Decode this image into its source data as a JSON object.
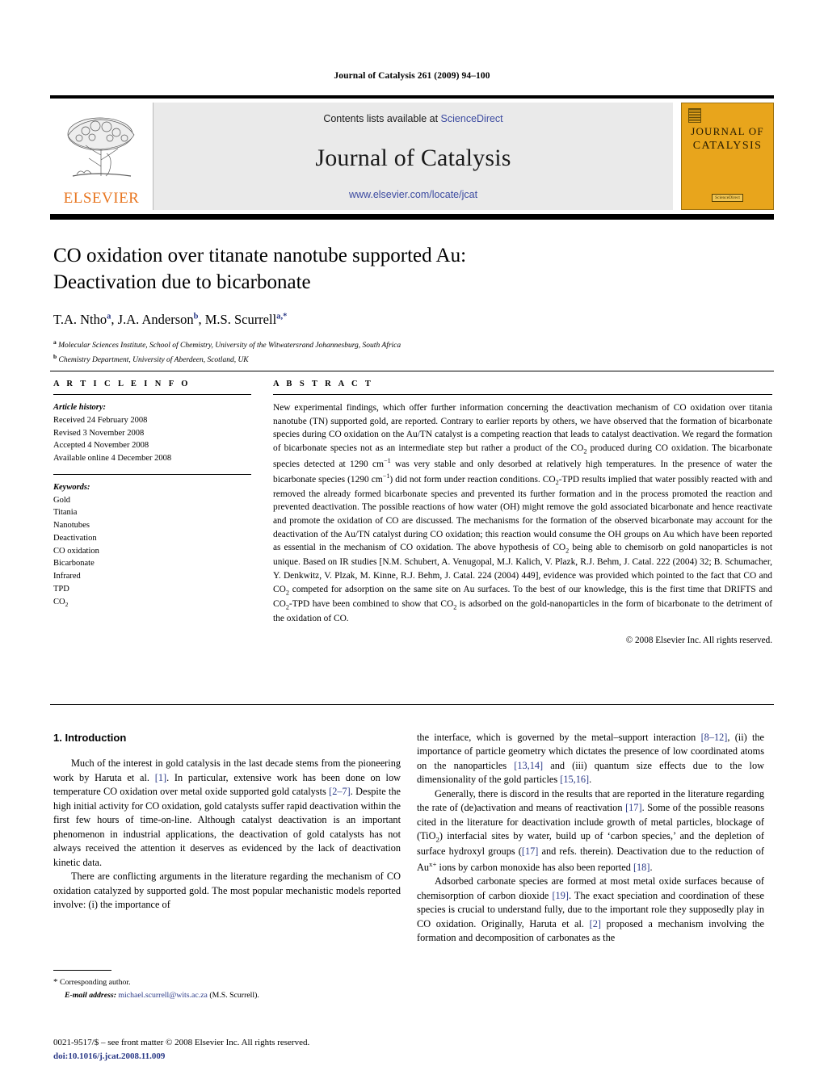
{
  "running_head": "Journal of Catalysis 261 (2009) 94–100",
  "masthead": {
    "contents_prefix": "Contents lists available at ",
    "sciencedirect": "ScienceDirect",
    "journal_name": "Journal of Catalysis",
    "journal_url": "www.elsevier.com/locate/jcat",
    "publisher_logo_text": "ELSEVIER",
    "cover": {
      "line1": "JOURNAL OF",
      "line2": "CATALYSIS",
      "badge": "ScienceDirect"
    },
    "accent_colors": {
      "elsevier_orange": "#E87722",
      "link_blue": "#3b4aa0",
      "cover_gold": "#E8A51C",
      "masthead_grey": "#eaeaea"
    }
  },
  "article": {
    "title_line1": "CO oxidation over titanate nanotube supported Au:",
    "title_line2": "Deactivation due to bicarbonate",
    "authors": [
      {
        "name": "T.A. Ntho",
        "marks": "a"
      },
      {
        "name": "J.A. Anderson",
        "marks": "b"
      },
      {
        "name": "M.S. Scurrell",
        "marks": "a,*"
      }
    ],
    "affiliations": [
      {
        "mark": "a",
        "text": "Molecular Sciences Institute, School of Chemistry, University of the Witwatersrand Johannesburg, South Africa"
      },
      {
        "mark": "b",
        "text": "Chemistry Department, University of Aberdeen, Scotland, UK"
      }
    ]
  },
  "article_info": {
    "heading": "A R T I C L E    I N F O",
    "history_label": "Article history:",
    "history": [
      "Received 24 February 2008",
      "Revised 3 November 2008",
      "Accepted 4 November 2008",
      "Available online 4 December 2008"
    ],
    "keywords_label": "Keywords:",
    "keywords": [
      "Gold",
      "Titania",
      "Nanotubes",
      "Deactivation",
      "CO oxidation",
      "Bicarbonate",
      "Infrared",
      "TPD"
    ],
    "keyword_last_html": "CO<sub>2</sub>"
  },
  "abstract": {
    "heading": "A B S T R A C T",
    "body_html": "New experimental findings, which offer further information concerning the deactivation mechanism of CO oxidation over titania nanotube (TN) supported gold, are reported. Contrary to earlier reports by others, we have observed that the formation of bicarbonate species during CO oxidation on the Au/TN catalyst is a competing reaction that leads to catalyst deactivation. We regard the formation of bicarbonate species not as an intermediate step but rather a product of the CO<sub>2</sub> produced during CO oxidation. The bicarbonate species detected at 1290 cm<sup class=\"inl\">&#8722;1</sup> was very stable and only desorbed at relatively high temperatures. In the presence of water the bicarbonate species (1290 cm<sup class=\"inl\">&#8722;1</sup>) did not form under reaction conditions. CO<sub>2</sub>-TPD results implied that water possibly reacted with and removed the already formed bicarbonate species and prevented its further formation and in the process promoted the reaction and prevented deactivation. The possible reactions of how water (OH) might remove the gold associated bicarbonate and hence reactivate and promote the oxidation of CO are discussed. The mechanisms for the formation of the observed bicarbonate may account for the deactivation of the Au/TN catalyst during CO oxidation; this reaction would consume the OH groups on Au which have been reported as essential in the mechanism of CO oxidation. The above hypothesis of CO<sub>2</sub> being able to chemisorb on gold nanoparticles is not unique. Based on IR studies [N.M. Schubert, A. Venugopal, M.J. Kalich, V. Plazk, R.J. Behm, J. Catal. 222 (2004) 32; B. Schumacher, Y. Denkwitz, V. Plzak, M. Kinne, R.J. Behm, J. Catal. 224 (2004) 449], evidence was provided which pointed to the fact that CO and CO<sub>2</sub> competed for adsorption on the same site on Au surfaces. To the best of our knowledge, this is the first time that DRIFTS and CO<sub>2</sub>-TPD have been combined to show that CO<sub>2</sub> is adsorbed on the gold-nanoparticles in the form of bicarbonate to the detriment of the oxidation of CO.",
    "copyright": "© 2008 Elsevier Inc. All rights reserved."
  },
  "body": {
    "section_heading": "1. Introduction",
    "left_paragraphs_html": [
      "Much of the interest in gold catalysis in the last decade stems from the pioneering work by Haruta et al. <span class=\"ref\">[1]</span>. In particular, extensive work has been done on low temperature CO oxidation over metal oxide supported gold catalysts <span class=\"ref\">[2–7]</span>. Despite the high initial activity for CO oxidation, gold catalysts suffer rapid deactivation within the first few hours of time-on-line. Although catalyst deactivation is an important phenomenon in industrial applications, the deactivation of gold catalysts has not always received the attention it deserves as evidenced by the lack of deactivation kinetic data.",
      "There are conflicting arguments in the literature regarding the mechanism of CO oxidation catalyzed by supported gold. The most popular mechanistic models reported involve: (i) the importance of"
    ],
    "right_paragraphs_html": [
      "the interface, which is governed by the metal–support interaction <span class=\"ref\">[8–12]</span>, (ii) the importance of particle geometry which dictates the presence of low coordinated atoms on the nanoparticles <span class=\"ref\">[13,14]</span> and (iii) quantum size effects due to the low dimensionality of the gold particles <span class=\"ref\">[15,16]</span>.",
      "Generally, there is discord in the results that are reported in the literature regarding the rate of (de)activation and means of reactivation <span class=\"ref\">[17]</span>. Some of the possible reasons cited in the literature for deactivation include growth of metal particles, blockage of (TiO<sub>2</sub>) interfacial sites by water, build up of ‘carbon species,’ and the depletion of surface hydroxyl groups (<span class=\"ref\">[17]</span> and refs. therein). Deactivation due to the reduction of Au<sup class=\"inl\">x+</sup> ions by carbon monoxide has also been reported <span class=\"ref\">[18]</span>.",
      "Adsorbed carbonate species are formed at most metal oxide surfaces because of chemisorption of carbon dioxide <span class=\"ref\">[19]</span>. The exact speciation and coordination of these species is crucial to understand fully, due to the important role they supposedly play in CO oxidation. Originally, Haruta et al. <span class=\"ref\">[2]</span> proposed a mechanism involving the formation and decomposition of carbonates as the"
    ],
    "first_right_paragraph_indent": false
  },
  "footnotes": {
    "corresponding_author": "Corresponding author.",
    "email_label": "E-mail address:",
    "email": "michael.scurrell@wits.ac.za",
    "email_owner": "(M.S. Scurrell).",
    "star": "*"
  },
  "imprint": {
    "issn_line": "0021-9517/$ – see front matter  © 2008 Elsevier Inc. All rights reserved.",
    "doi": "doi:10.1016/j.jcat.2008.11.009"
  }
}
